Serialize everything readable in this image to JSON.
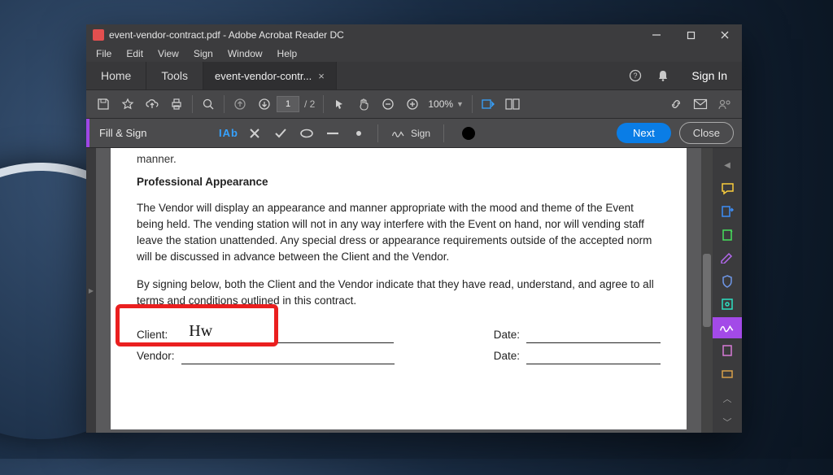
{
  "window": {
    "title": "event-vendor-contract.pdf - Adobe Acrobat Reader DC",
    "min_tip": "Minimize",
    "max_tip": "Maximize",
    "close_tip": "Close"
  },
  "menu": {
    "file": "File",
    "edit": "Edit",
    "view": "View",
    "sign": "Sign",
    "window": "Window",
    "help": "Help"
  },
  "tabs": {
    "home": "Home",
    "tools": "Tools",
    "active": "event-vendor-contr...",
    "signin": "Sign In"
  },
  "toolbar": {
    "page_current": "1",
    "page_total": "/  2",
    "zoom_level": "100%"
  },
  "fillsign": {
    "title": "Fill & Sign",
    "text_tool": "IAb",
    "sign_label": "Sign",
    "next": "Next",
    "close": "Close"
  },
  "document": {
    "cutoff_word": "manner.",
    "heading": "Professional Appearance",
    "para1": "The Vendor will display an appearance and manner appropriate with the mood and theme of the Event being held. The vending station will not in any way interfere with the Event on hand, nor will vending staff leave the station unattended. Any special dress or appearance requirements outside of the accepted norm will be discussed in advance between the Client and the Vendor.",
    "para2": "By signing below, both the Client and the Vendor indicate that they have read, understand, and agree to all terms and conditions outlined in this contract.",
    "client_label": "Client:",
    "vendor_label": "Vendor:",
    "date_label": "Date:",
    "signature_glyph": "Hw"
  }
}
